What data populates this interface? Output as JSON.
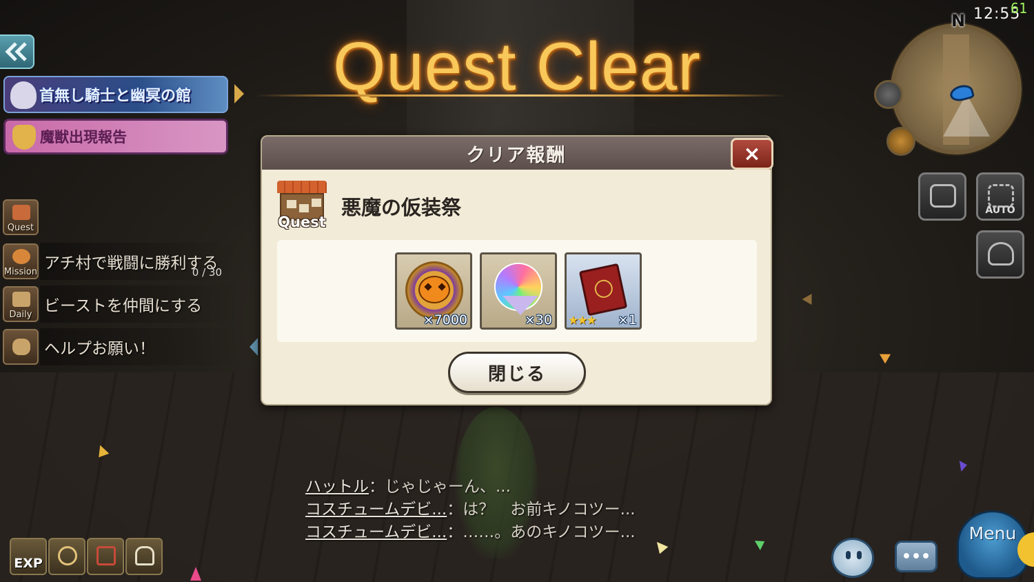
{
  "title": "Quest Clear",
  "status": {
    "time": "12:55",
    "fps": "61",
    "compass_north": "N"
  },
  "sidebar": {
    "event_banner": "首無し騎士と幽冥の館",
    "beast_banner": "魔獣出現報告",
    "rows": [
      {
        "icon": "Quest",
        "text": "",
        "progress": ""
      },
      {
        "icon": "Mission",
        "text": "アチ村で戦闘に勝利する",
        "progress": "0 / 30"
      },
      {
        "icon": "Daily",
        "text": "ビーストを仲間にする",
        "progress": ""
      },
      {
        "icon": "",
        "text": "ヘルプお願い！",
        "progress": ""
      }
    ]
  },
  "right_buttons": {
    "auto_label": "AUTO"
  },
  "dialog": {
    "title": "クリア報酬",
    "close_icon": "×",
    "quest_badge_label": "Quest",
    "quest_name": "悪魔の仮装祭",
    "rewards": [
      {
        "icon": "pumpkin-coin-icon",
        "qty": "×7000"
      },
      {
        "icon": "rainbow-gem-icon",
        "qty": "×30"
      },
      {
        "icon": "red-tome-icon",
        "stars": "★★★",
        "qty": "×1"
      }
    ],
    "close_button": "閉じる"
  },
  "chat": [
    {
      "speaker": "ハットル",
      "sep": "：",
      "text": "じゃじゃーん、..."
    },
    {
      "speaker": "コスチュームデビ...",
      "sep": "：",
      "text": "は？　お前キノコツー..."
    },
    {
      "speaker": "コスチュームデビ...",
      "sep": "：",
      "text": "……。あのキノコツー..."
    }
  ],
  "bottom_left": {
    "exp_label": "EXP"
  },
  "bottom_right": {
    "chat_icon": "•••",
    "menu_label": "Menu"
  },
  "colors": {
    "title_gold": "#f8c85a",
    "dialog_bg": "#f1ebd8",
    "close_red": "#b14a3e"
  }
}
